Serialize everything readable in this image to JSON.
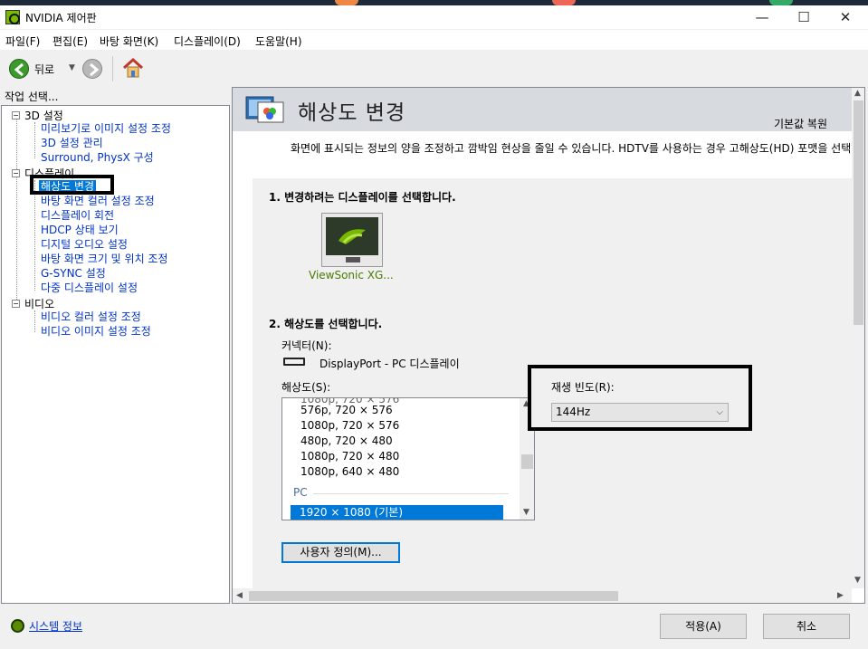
{
  "window": {
    "title": "NVIDIA 제어판",
    "min_glyph": "—",
    "max_glyph": "☐",
    "close_glyph": "✕"
  },
  "menu": [
    "파일(F)",
    "편집(E)",
    "바탕 화면(K)",
    "디스플레이(D)",
    "도움말(H)"
  ],
  "toolbar": {
    "back_label": "뒤로"
  },
  "left": {
    "task_label": "작업 선택...",
    "tree": {
      "cat_3d": "3D 설정",
      "items_3d": [
        "미리보기로 이미지 설정 조정",
        "3D 설정 관리",
        "Surround, PhysX 구성"
      ],
      "cat_display": "디스플레이",
      "items_display": [
        "해상도 변경",
        "바탕 화면 컬러 설정 조정",
        "디스플레이 회전",
        "HDCP 상태 보기",
        "디지털 오디오 설정",
        "바탕 화면 크기 및 위치 조정",
        "G-SYNC 설정",
        "다중 디스플레이 설정"
      ],
      "cat_video": "비디오",
      "items_video": [
        "비디오 컬러 설정 조정",
        "비디오 이미지 설정 조정"
      ]
    }
  },
  "page": {
    "title": "해상도 변경",
    "restore": "기본값 복원",
    "description": "화면에 표시되는 정보의 양을 조정하고 깜박임 현상을 줄일 수 있습니다. HDTV를 사용하는 경우 고해상도(HD) 포맷을 선택하",
    "step1": "1. 변경하려는 디스플레이를 선택합니다.",
    "monitor_name": "ViewSonic XG...",
    "step2": "2. 해상도를 선택합니다.",
    "connector_label": "커넥터(N):",
    "connector_value": "DisplayPort - PC 디스플레이",
    "resolution_label": "해상도(S):",
    "resolutions": [
      "576p, 720 × 576",
      "1080p, 720 × 576",
      "480p, 720 × 480",
      "1080p, 720 × 480",
      "1080p, 640 × 480"
    ],
    "group_pc": "PC",
    "selected_resolution": "1920 × 1080 (기본)",
    "refresh_label": "재생 빈도(R):",
    "refresh_value": "144Hz",
    "custom_button": "사용자 정의(M)..."
  },
  "footer": {
    "system_info": "시스템 정보",
    "apply": "적용(A)",
    "cancel": "취소"
  },
  "colors": {
    "accent": "#0078d7",
    "nvidia_green": "#76b900",
    "link": "#0033cc"
  }
}
